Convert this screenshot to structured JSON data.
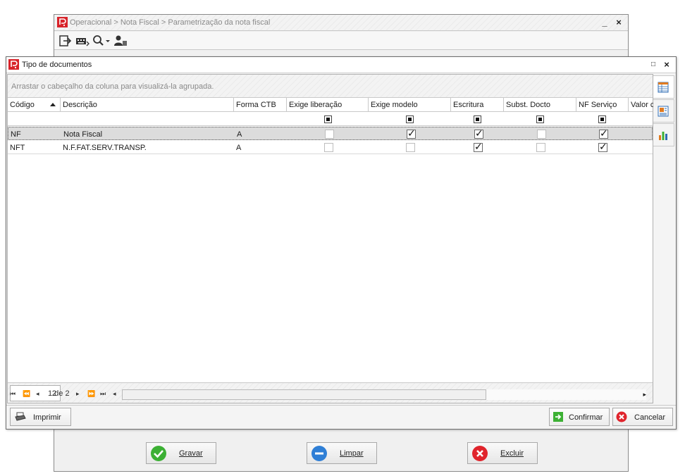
{
  "parent_window": {
    "title": "Operacional > Nota Fiscal > Parametrização da nota fiscal",
    "minimize": "_",
    "close": "×",
    "toolbar": [
      {
        "name": "exit-icon"
      },
      {
        "name": "keyboard-icon"
      },
      {
        "name": "search-icon"
      },
      {
        "name": "user-icon"
      }
    ],
    "buttons": {
      "gravar": "Gravar",
      "limpar": "Limpar",
      "excluir": "Excluir"
    }
  },
  "dialog": {
    "title": "Tipo de documentos",
    "maximize": "□",
    "close": "×",
    "group_panel_hint": "Arrastar o cabeçalho da coluna para visualizá-la agrupada.",
    "columns": [
      "Código",
      "Descrição",
      "Forma CTB",
      "Exige liberação",
      "Exige modelo",
      "Escritura",
      "Subst. Docto",
      "NF Serviço",
      "Valor c"
    ],
    "sorted_column": "Código",
    "rows": [
      {
        "codigo": "NF",
        "descricao": "Nota Fiscal",
        "forma_ctb": "A",
        "exige_liberacao": false,
        "exige_modelo": true,
        "escritura": true,
        "subst_docto": false,
        "nf_servico": true,
        "selected": true
      },
      {
        "codigo": "NFT",
        "descricao": "N.F.FAT.SERV.TRANSP.",
        "forma_ctb": "A",
        "exige_liberacao": false,
        "exige_modelo": false,
        "escritura": true,
        "subst_docto": false,
        "nf_servico": true,
        "selected": false
      }
    ],
    "record_count": "2",
    "pager": {
      "page_label": "1 de 2"
    },
    "buttons": {
      "imprimir": "Imprimir",
      "confirmar": "Confirmar",
      "cancelar": "Cancelar"
    },
    "side_tabs": [
      {
        "name": "grid-view-icon"
      },
      {
        "name": "card-view-icon"
      },
      {
        "name": "chart-view-icon"
      }
    ]
  },
  "colors": {
    "brand_red": "#d8232a",
    "green_ok": "#3cb034",
    "blue_clear": "#2f7fd6",
    "red_delete": "#e0242c"
  }
}
